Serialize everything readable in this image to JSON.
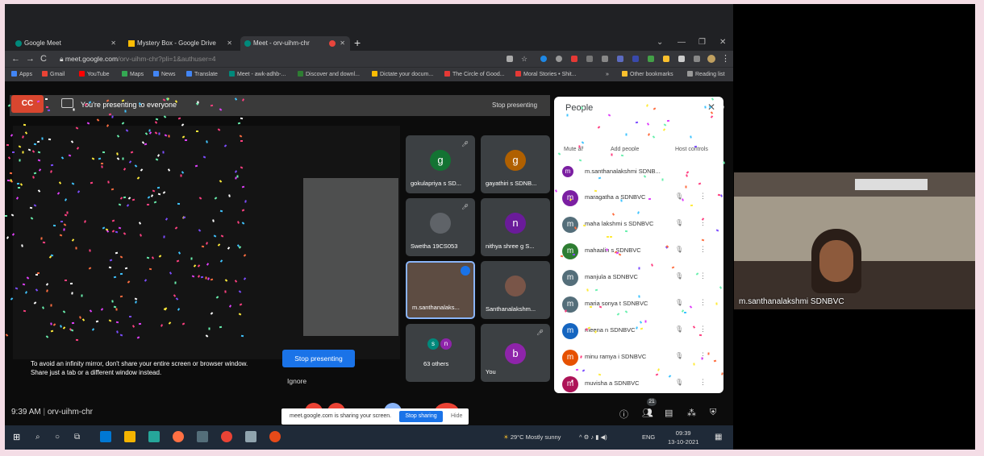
{
  "browser": {
    "tabs": [
      {
        "label": "Google Meet",
        "icon": "meet-icon",
        "color": "#00897b"
      },
      {
        "label": "Mystery Box - Google Drive",
        "icon": "drive-icon",
        "color": "#fbbc04"
      },
      {
        "label": "Meet - orv-uihm-chr",
        "icon": "meet-icon",
        "color": "#00897b"
      }
    ],
    "url_host": "meet.google.com",
    "url_path": "/orv-uihm-chr?pli=1&authuser=4",
    "bookmarks": [
      {
        "label": "Apps",
        "color": "#4285f4"
      },
      {
        "label": "Gmail",
        "color": "#ea4335"
      },
      {
        "label": "YouTube",
        "color": "#ff0000"
      },
      {
        "label": "Maps",
        "color": "#34a853"
      },
      {
        "label": "News",
        "color": "#4285f4"
      },
      {
        "label": "Translate",
        "color": "#4285f4"
      },
      {
        "label": "Meet - awk-adhb-...",
        "color": "#00897b"
      },
      {
        "label": "Discover and downl...",
        "color": "#2e7d32"
      },
      {
        "label": "Dictate your docum...",
        "color": "#fbbc04"
      },
      {
        "label": "The Circle of Good...",
        "color": "#e53935"
      },
      {
        "label": "Moral Stories • Shit...",
        "color": "#e53935"
      }
    ],
    "other_bookmarks": "Other bookmarks",
    "reading_list": "Reading list"
  },
  "meet": {
    "presenting_text": "You're presenting to everyone",
    "stop_presenting_link": "Stop presenting",
    "infinity_warning": "To avoid an infinity mirror, don't share your entire screen or browser window. Share just a tab or a different window instead.",
    "stop_presenting_button": "Stop presenting",
    "ignore": "Ignore",
    "time": "9:39 AM",
    "meeting_code": "orv-uihm-chr",
    "share_message": "meet.google.com is sharing your screen.",
    "stop_sharing": "Stop sharing",
    "hide": "Hide",
    "participant_count": "21",
    "tiles": [
      {
        "name": "gokulapriya s SD...",
        "initial": "g",
        "color": "#137333"
      },
      {
        "name": "gayathiri s SDNB...",
        "initial": "g",
        "color": "#b06000"
      },
      {
        "name": "Swetha 19CS053",
        "initial": "",
        "color": "#5f6368"
      },
      {
        "name": "nithya shree g S...",
        "initial": "n",
        "color": "#6a1b9a"
      },
      {
        "name": "m.santhanalaks...",
        "initial": "",
        "color": "#8d6e63"
      },
      {
        "name": "Santhanalakshm...",
        "initial": "",
        "color": "#795548"
      },
      {
        "name": "63 others",
        "initial": "s n",
        "color": "#3c4043"
      },
      {
        "name": "You",
        "initial": "b",
        "color": "#8e24aa"
      }
    ]
  },
  "people": {
    "title": "People",
    "mute_all": "Mute all",
    "add_people": "Add people",
    "host_controls": "Host controls",
    "list": [
      {
        "name": "m.santhanalakshmi SDNB...",
        "initial": "m",
        "color": "#7b1fa2"
      },
      {
        "name": "maragatha a SDNBVC",
        "initial": "m",
        "color": "#7b1fa2"
      },
      {
        "name": "maha lakshmi s SDNBVC",
        "initial": "m",
        "color": "#546e7a"
      },
      {
        "name": "mahaalin s SDNBVC",
        "initial": "m",
        "color": "#2e7d32"
      },
      {
        "name": "manjula a SDNBVC",
        "initial": "m",
        "color": "#546e7a"
      },
      {
        "name": "maria sonya t SDNBVC",
        "initial": "m",
        "color": "#546e7a"
      },
      {
        "name": "meena n SDNBVC",
        "initial": "m",
        "color": "#1565c0"
      },
      {
        "name": "minu ramya i SDNBVC",
        "initial": "m",
        "color": "#e65100"
      },
      {
        "name": "muvisha a SDNBVC",
        "initial": "m",
        "color": "#ad1457"
      }
    ]
  },
  "taskbar": {
    "weather": "29°C  Mostly sunny",
    "lang": "ENG",
    "time": "09:39",
    "date": "13-10-2021"
  },
  "camera": {
    "name": "m.santhanalakshmi SDNBVC"
  }
}
